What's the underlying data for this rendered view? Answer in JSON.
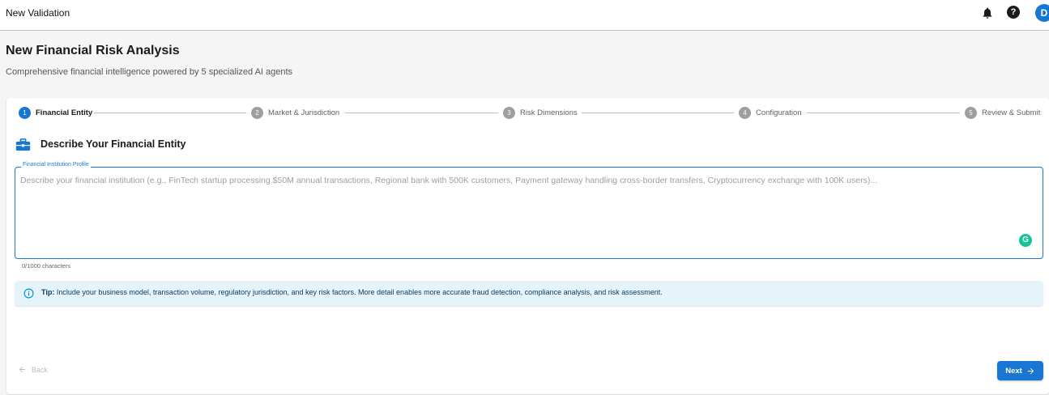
{
  "app": {
    "title": "New Validation",
    "avatar_initial": "D"
  },
  "page": {
    "title": "New Financial Risk Analysis",
    "subtitle": "Comprehensive financial intelligence powered by 5 specialized AI agents"
  },
  "stepper": {
    "active_index": 0,
    "steps": [
      {
        "number": "1",
        "label": "Financial Entity"
      },
      {
        "number": "2",
        "label": "Market & Jurisdiction"
      },
      {
        "number": "3",
        "label": "Risk Dimensions"
      },
      {
        "number": "4",
        "label": "Configuration"
      },
      {
        "number": "5",
        "label": "Review & Submit"
      }
    ]
  },
  "section": {
    "title": "Describe Your Financial Entity",
    "icon": "briefcase-icon"
  },
  "profile_field": {
    "label": "Financial Institution Profile",
    "value": "",
    "placeholder": "Describe your financial institution (e.g., FinTech startup processing $50M annual transactions, Regional bank with 500K customers, Payment gateway handling cross-border transfers, Cryptocurrency exchange with 100K users)...",
    "char_count": "0/1000 characters"
  },
  "tip": {
    "label": "Tip:",
    "text": "Include your business model, transaction volume, regulatory jurisdiction, and key risk factors. More detail enables more accurate fraud detection, compliance analysis, and risk assessment."
  },
  "nav": {
    "back_label": "Back",
    "next_label": "Next"
  },
  "colors": {
    "primary": "#1976d2",
    "tip_bg": "#e5f4fb",
    "grammarly": "#15c39a"
  }
}
